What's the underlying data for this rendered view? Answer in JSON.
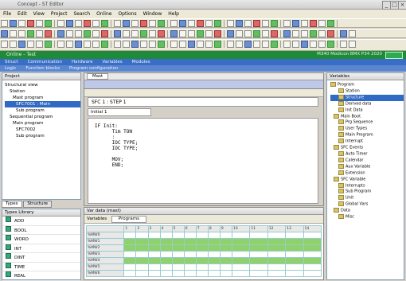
{
  "window": {
    "title": "Concept - ST Editor"
  },
  "menu": [
    "File",
    "Edit",
    "View",
    "Project",
    "Search",
    "Online",
    "Options",
    "Window",
    "Help"
  ],
  "greenbar": {
    "left": "Online - Test",
    "right": "M340 Modicon BMX P34 2020"
  },
  "bluebar": {
    "tabs": [
      "Struct",
      "Communication",
      "Hardware",
      "Variables",
      "Modules"
    ]
  },
  "bluebar2": {
    "tabs": [
      "Logic",
      "Function blocks",
      "Program configuration"
    ]
  },
  "left_tree": {
    "header": "Project",
    "items": [
      "Structural view",
      "Station",
      "Mast program",
      "SFC7001 : Main",
      "Sub program",
      "Sequential program",
      "Main program",
      "SFC7002",
      "Sub program"
    ]
  },
  "left_tabs": [
    "Types",
    "Structure"
  ],
  "library": {
    "header": "Types Library",
    "items": [
      "ADD",
      "BOOL",
      "WORD",
      "INT",
      "DINT",
      "TIME",
      "REAL"
    ]
  },
  "editor": {
    "tab": "Mast",
    "path": "SFC 1 : STEP 1",
    "step": "Initial 1",
    "code_lines": [
      "IF Init:",
      "      Tim TON",
      "      :",
      "      IOC TYPE;",
      "      IOC TYPE;",
      "",
      "      MOV;",
      "      END;"
    ]
  },
  "bottom_panel": {
    "header": "Var data (mast)",
    "filter_label": "Variables",
    "filter_value": "Programs"
  },
  "grid": {
    "header": [
      "",
      "1",
      "2",
      "3",
      "4",
      "5",
      "6",
      "7",
      "8",
      "9",
      "10",
      "11",
      "12",
      "13",
      "14"
    ],
    "rows": [
      {
        "label": "%MW0",
        "style": "w"
      },
      {
        "label": "%MW1",
        "style": "g"
      },
      {
        "label": "%MW2",
        "style": "g"
      },
      {
        "label": "%MW3",
        "style": "w"
      },
      {
        "label": "%MW4",
        "style": "g"
      },
      {
        "label": "%MW5",
        "style": "w"
      },
      {
        "label": "%MW6",
        "style": "w"
      }
    ]
  },
  "right_tree": {
    "header": "Variables",
    "items": [
      "Program",
      "Station",
      "Structure",
      "Derived data",
      "Init Data",
      "Main Boot",
      "Prg Sequence",
      "User Types",
      "Main Program",
      "Interrupt",
      "SFC Events",
      "Auto Timer",
      "Calendar",
      "Aux Variable",
      "Extension",
      "SFC Variable",
      "Interrupts",
      "Sub Program",
      "Unit",
      "Global Vars",
      "Data",
      "Misc"
    ]
  },
  "colors": {
    "green": "#1f8a3a",
    "blue": "#3a6ec6",
    "grid_green": "#8fd16a"
  }
}
